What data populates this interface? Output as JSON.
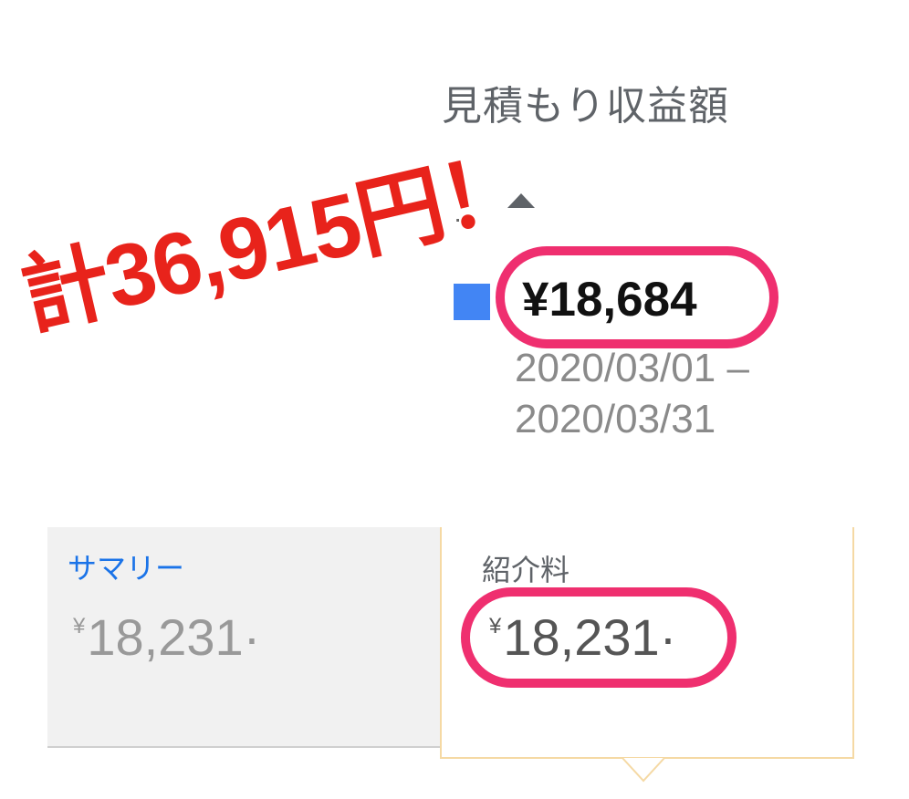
{
  "estimate": {
    "title": "見積もり収益額",
    "truncated_label": "…",
    "sort_icon": "triangle-up-icon",
    "legend_color": "#4285f4",
    "value": "¥18,684",
    "date_start": "2020/03/01 –",
    "date_end": "2020/03/31"
  },
  "annotation": {
    "total_text": "計36,915円！",
    "text_color": "#e8231b",
    "ring_color": "#ef2f6f"
  },
  "summary_tab": {
    "label": "サマリー",
    "currency": "¥",
    "value": "18,231·"
  },
  "fee_tab": {
    "label": "紹介料",
    "currency": "¥",
    "value": "18,231·"
  }
}
